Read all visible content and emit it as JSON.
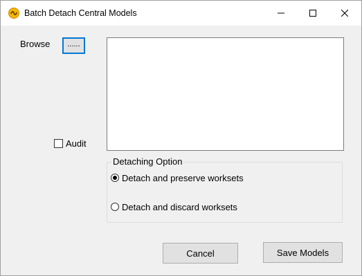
{
  "window": {
    "title": "Batch Detach Central Models",
    "controls": {
      "minimize_icon": "minimize-icon",
      "maximize_icon": "maximize-icon",
      "close_icon": "close-icon"
    }
  },
  "browse": {
    "label": "Browse",
    "button_label": "......"
  },
  "audit": {
    "label": "Audit",
    "checked": false
  },
  "detaching_option": {
    "title": "Detaching Option",
    "options": [
      {
        "label": "Detach and preserve worksets",
        "selected": true
      },
      {
        "label": "Detach and discard worksets",
        "selected": false
      }
    ]
  },
  "buttons": {
    "cancel": "Cancel",
    "save": "Save Models"
  },
  "colors": {
    "accent": "#0078d7",
    "window_bg": "#f0f0f0",
    "button_bg": "#e1e1e1"
  }
}
